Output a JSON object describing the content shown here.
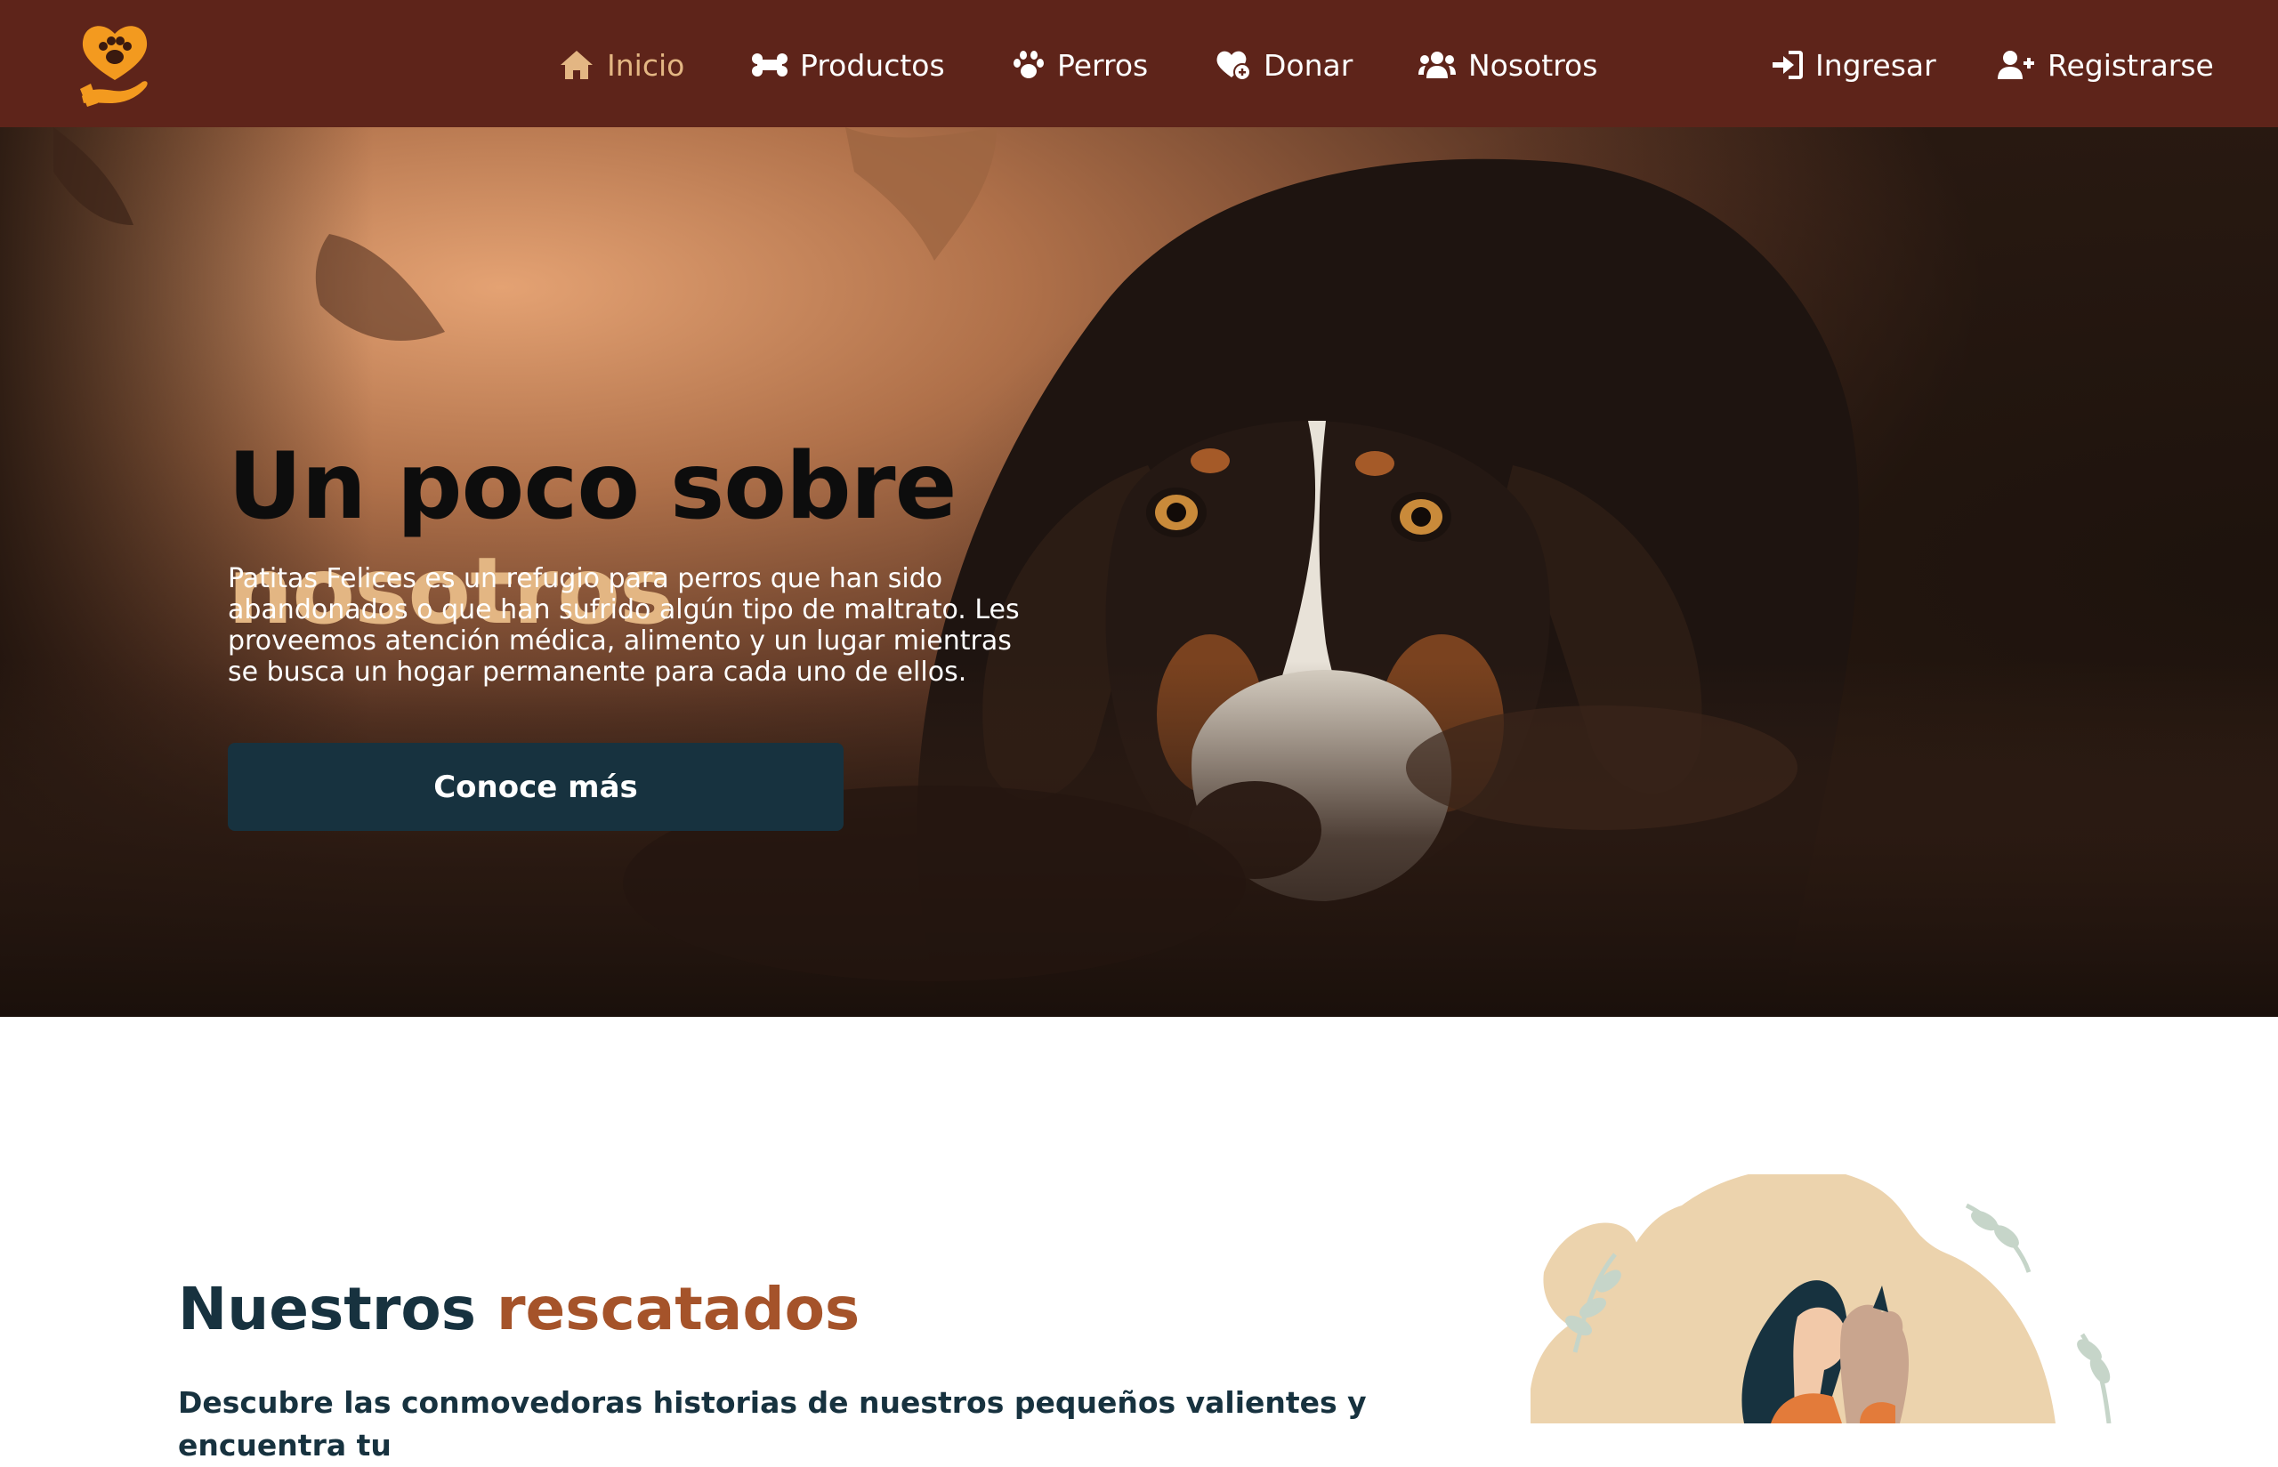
{
  "navbar": {
    "logo_icon": "paw-heart-hand-logo",
    "brand_color": "#5e241a",
    "active_color": "#e3b683",
    "items": [
      {
        "label": "Inicio",
        "icon": "home-icon",
        "active": true
      },
      {
        "label": "Productos",
        "icon": "bone-icon",
        "active": false
      },
      {
        "label": "Perros",
        "icon": "paw-icon",
        "active": false
      },
      {
        "label": "Donar",
        "icon": "heart-donate-icon",
        "active": false
      },
      {
        "label": "Nosotros",
        "icon": "users-icon",
        "active": false
      }
    ],
    "auth": [
      {
        "label": "Ingresar",
        "icon": "sign-in-icon"
      },
      {
        "label": "Registrarse",
        "icon": "user-plus-icon"
      }
    ]
  },
  "hero": {
    "title": "Un poco sobre",
    "title_accent": "nosotros",
    "description": "Patitas Felices es un refugio para perros que han sido abandonados o que han sufrido algún tipo de maltrato. Les proveemos atención médica, alimento y un lugar mientras se busca un hogar permanente para cada uno de ellos.",
    "button": "Conoce más",
    "button_color": "#17323f"
  },
  "rescued": {
    "title": "Nuestros",
    "title_accent": "rescatados",
    "description": "Descubre las conmovedoras historias de nuestros pequeños valientes y encuentra tu"
  }
}
